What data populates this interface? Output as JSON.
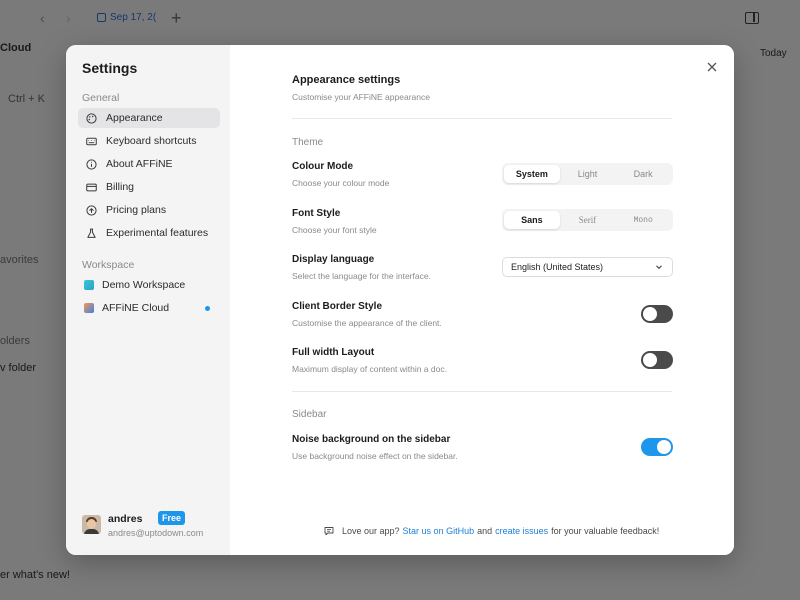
{
  "background": {
    "tab_label": "Sep 17, 2(",
    "left_cloud": "Cloud",
    "left_shortcut": "Ctrl + K",
    "left_favorites": "avorites",
    "left_folders": "olders",
    "left_new_folder": "v folder",
    "left_whats_new": "er what's new!",
    "right_today": "Today"
  },
  "settings": {
    "title": "Settings",
    "general_label": "General",
    "general_items": [
      {
        "label": "Appearance",
        "icon": "palette-icon",
        "active": true
      },
      {
        "label": "Keyboard shortcuts",
        "icon": "keyboard-icon"
      },
      {
        "label": "About AFFiNE",
        "icon": "info-icon"
      },
      {
        "label": "Billing",
        "icon": "credit-card-icon"
      },
      {
        "label": "Pricing plans",
        "icon": "upgrade-icon"
      },
      {
        "label": "Experimental features",
        "icon": "experiment-icon"
      }
    ],
    "workspace_label": "Workspace",
    "workspace_items": [
      {
        "label": "Demo Workspace"
      },
      {
        "label": "AFFiNE Cloud"
      }
    ],
    "account": {
      "name": "andres",
      "badge": "Free",
      "email": "andres@uptodown.com"
    }
  },
  "appearance": {
    "title": "Appearance settings",
    "subtitle": "Customise your AFFiNE appearance",
    "theme_section": "Theme",
    "colour_mode": {
      "title": "Colour Mode",
      "desc": "Choose your colour mode",
      "options": [
        "System",
        "Light",
        "Dark"
      ],
      "selected": "System"
    },
    "font_style": {
      "title": "Font Style",
      "desc": "Choose your font style",
      "options": [
        "Sans",
        "Serif",
        "Mono"
      ],
      "selected": "Sans"
    },
    "display_language": {
      "title": "Display language",
      "desc": "Select the language for the interface.",
      "value": "English (United States)"
    },
    "client_border": {
      "title": "Client Border Style",
      "desc": "Customise the appearance of the client.",
      "enabled": false
    },
    "full_width": {
      "title": "Full width Layout",
      "desc": "Maximum display of content within a doc.",
      "enabled": false
    },
    "sidebar_section": "Sidebar",
    "noise_bg": {
      "title": "Noise background on the sidebar",
      "desc": "Use background noise effect on the sidebar.",
      "enabled": true
    }
  },
  "footer": {
    "prefix": "Love our app?",
    "github_link": "Star us on GitHub",
    "and": "and",
    "issues_link": "create issues",
    "suffix": "for your valuable feedback!"
  },
  "colors": {
    "accent": "#1e96eb",
    "toggle_off": "#4a4a4a"
  }
}
